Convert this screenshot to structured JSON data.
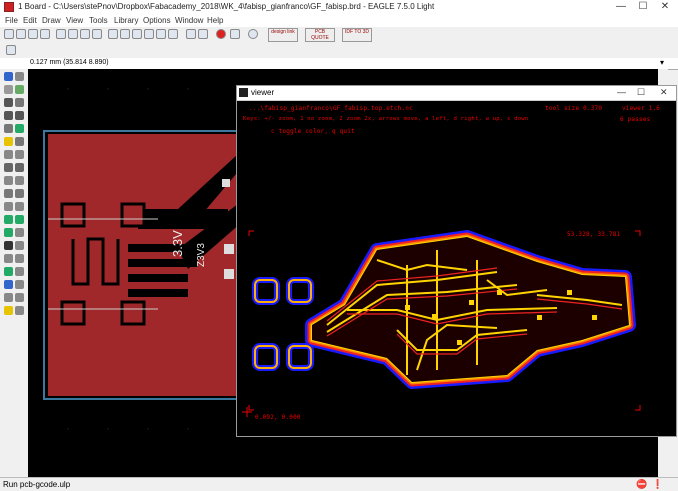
{
  "window": {
    "title": "1 Board - C:\\Users\\stePnov\\Dropbox\\Fabacademy_2018\\WK_4\\fabisp_gianfranco\\GF_fabisp.brd - EAGLE 7.5.0 Light",
    "minimize": "—",
    "maximize": "☐",
    "close": "✕"
  },
  "menu": [
    "File",
    "Edit",
    "Draw",
    "View",
    "Tools",
    "Library",
    "Options",
    "Window",
    "Help"
  ],
  "toolbar": {
    "design_link": "design link",
    "pcb_quote": "PCB QUOTE",
    "idf": "IDF TO 3D"
  },
  "coordinate_readout": "0.127 mm (35.814 8.890)",
  "board_labels": {
    "voltage": "3.3V",
    "diode": "Z3V3"
  },
  "viewer": {
    "title": "viewer",
    "file": "...\\fabisp_gianfranco\\GF_fabisp.top.etch.nc",
    "tool_size": "tool size 0.370",
    "version": "viewer 1.6",
    "keys": "Keys: +/- zoom, 1 no zoom, 2 zoom 2x, arrows move, a left, d right, w up, s down",
    "passes": "6 passes",
    "toggle": "c toggle color, q quit",
    "coord_top": "53.328, 33.781",
    "coord_bottom": "0.092, 0.000",
    "minimize": "—",
    "maximize": "☐",
    "close": "✕"
  },
  "status": {
    "message": "Run pcb-gcode.ulp"
  },
  "colors": {
    "board": "#a0282a",
    "outline": "#3a78a0",
    "viewer_text": "#ee1111",
    "trace_core": "#ffd400",
    "trace_halo": "#1a1aff"
  }
}
